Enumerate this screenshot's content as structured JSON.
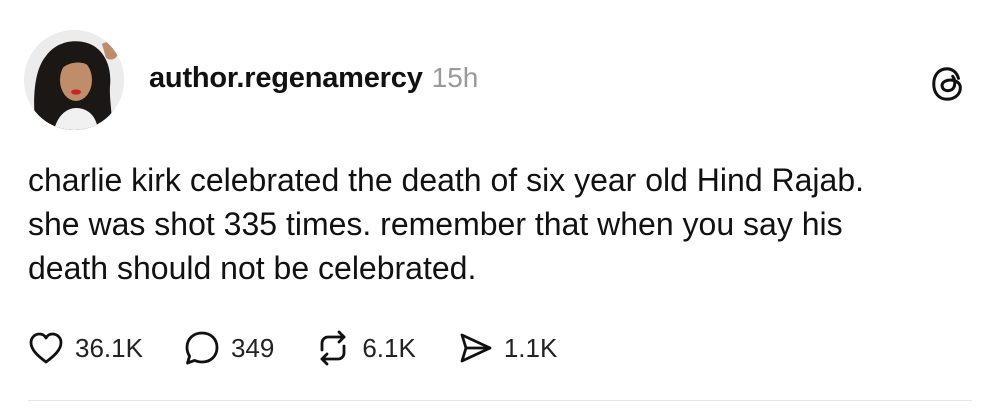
{
  "post": {
    "author": "author.regenamercy",
    "time": "15h",
    "text": "charlie kirk celebrated the death of six year old Hind Rajab.\nshe was shot 335 times. remember that when you say his\ndeath should not be celebrated."
  },
  "actions": {
    "likes": "36.1K",
    "replies": "349",
    "reposts": "6.1K",
    "shares": "1.1K"
  },
  "icons": {
    "like": "heart-icon",
    "reply": "comment-bubble-icon",
    "repost": "repost-icon",
    "share": "send-icon",
    "brand": "threads-logo-icon"
  },
  "colors": {
    "text": "#111111",
    "muted": "#9a9a9a",
    "divider": "#e5e5e5"
  }
}
